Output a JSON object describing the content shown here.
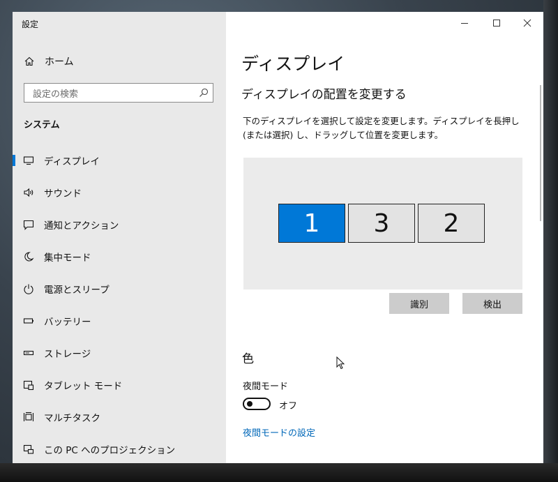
{
  "window": {
    "title": "設定",
    "caption": {
      "minimize_icon": "minimize-icon",
      "maximize_icon": "maximize-icon",
      "close_icon": "close-icon"
    }
  },
  "sidebar": {
    "home_label": "ホーム",
    "search_placeholder": "設定の検索",
    "section_title": "システム",
    "items": [
      {
        "label": "ディスプレイ",
        "icon": "monitor-icon",
        "active": true
      },
      {
        "label": "サウンド",
        "icon": "speaker-icon"
      },
      {
        "label": "通知とアクション",
        "icon": "notification-icon"
      },
      {
        "label": "集中モード",
        "icon": "moon-icon"
      },
      {
        "label": "電源とスリープ",
        "icon": "power-icon"
      },
      {
        "label": "バッテリー",
        "icon": "battery-icon"
      },
      {
        "label": "ストレージ",
        "icon": "storage-icon"
      },
      {
        "label": "タブレット モード",
        "icon": "tablet-icon"
      },
      {
        "label": "マルチタスク",
        "icon": "multitask-icon"
      },
      {
        "label": "この PC へのプロジェクション",
        "icon": "projection-icon"
      }
    ]
  },
  "main": {
    "title": "ディスプレイ",
    "arrange_heading": "ディスプレイの配置を変更する",
    "arrange_description": "下のディスプレイを選択して設定を変更します。ディスプレイを長押し (または選択) し、ドラッグして位置を変更します。",
    "monitors": [
      {
        "number": "1",
        "selected": true
      },
      {
        "number": "3",
        "selected": false
      },
      {
        "number": "2",
        "selected": false
      }
    ],
    "identify_button": "識別",
    "detect_button": "検出",
    "color_heading": "色",
    "night_light_label": "夜間モード",
    "night_light_state": "オフ",
    "night_light_on": false,
    "night_light_settings_link": "夜間モードの設定"
  },
  "colors": {
    "accent": "#0078d7",
    "link": "#0067b8",
    "sidebar_bg": "#e9e9e9"
  }
}
